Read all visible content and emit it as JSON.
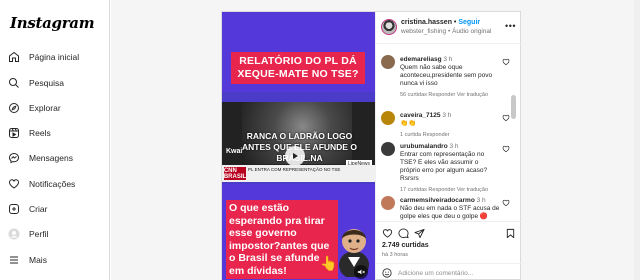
{
  "brand": {
    "logo_text": "Instagram"
  },
  "nav": {
    "items": [
      {
        "label": "Página inicial",
        "icon": "home-icon"
      },
      {
        "label": "Pesquisa",
        "icon": "search-icon"
      },
      {
        "label": "Explorar",
        "icon": "compass-icon"
      },
      {
        "label": "Reels",
        "icon": "reels-icon"
      },
      {
        "label": "Mensagens",
        "icon": "messenger-icon"
      },
      {
        "label": "Notificações",
        "icon": "heart-icon"
      },
      {
        "label": "Criar",
        "icon": "plus-square-icon"
      },
      {
        "label": "Perfil",
        "icon": "avatar-icon"
      },
      {
        "label": "Mais",
        "icon": "menu-icon"
      }
    ]
  },
  "post": {
    "media": {
      "headline_top": "RELATÓRIO DO PL DÁ XEQUE-MATE NO TSE?",
      "video_overlay": "RANCA O LADRÃO LOGO ANTES QUE ELE AFUNDE O BRASIL.NA",
      "watermark": "Kwai",
      "network_logo": "CNN BRASIL",
      "ticker": "PL ENTRA COM REPRESENTAÇÃO NO TSE",
      "channel_tag": "LipeNews",
      "headline_bottom": "O que estão esperando pra tirar esse governo impostor?antes que o Brasil se afunde em dívidas!"
    },
    "header": {
      "username": "cristina.hassen",
      "separator": "•",
      "follow_label": "Seguir",
      "subtitle": "webster_fishing • Áudio original",
      "more_label": "•••"
    },
    "comments": [
      {
        "user": "edemareliasg",
        "time": "3 h",
        "text": "Quem não sabe oque aconteceu,presidente sem povo nunca vi isso",
        "meta": "56 curtidas   Responder   Ver tradução",
        "avatar_color": "#8a6a4f"
      },
      {
        "user": "caveira_7125",
        "time": "3 h",
        "text": "👏👏",
        "meta": "1 curtida   Responder",
        "avatar_color": "#b8860b"
      },
      {
        "user": "urubumalandro",
        "time": "3 h",
        "text": "Entrar com representação no TSE? E eles vão assumir o próprio erro por algum acaso? Rsrsrs",
        "meta": "17 curtidas   Responder   Ver tradução",
        "avatar_color": "#3a3a3a"
      },
      {
        "user": "carmemsilveiradocarmo",
        "time": "3 h",
        "text": "Não deu em nada o STF acusa de golpe eles que deu o golpe 🔴",
        "meta": "",
        "avatar_color": "#c07a5a"
      }
    ],
    "likes": "2.749 curtidas",
    "time_ago": "há 3 horas",
    "comment_placeholder": "Adicione um comentário..."
  }
}
